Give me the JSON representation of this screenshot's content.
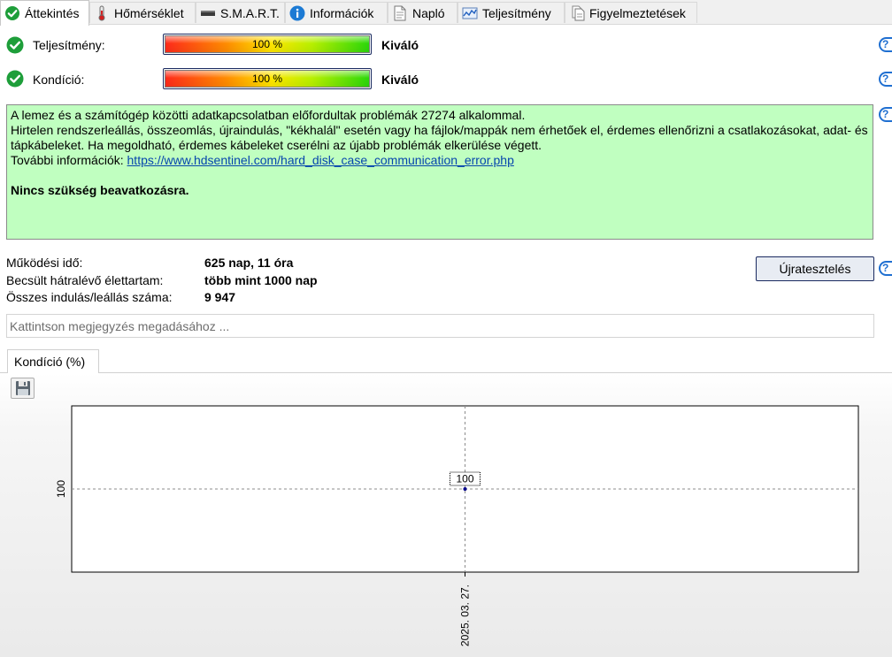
{
  "tabs": [
    {
      "label": "Áttekintés",
      "icon": "check-circle-icon"
    },
    {
      "label": "Hőmérséklet",
      "icon": "thermometer-icon"
    },
    {
      "label": "S.M.A.R.T.",
      "icon": "drive-icon"
    },
    {
      "label": "Információk",
      "icon": "info-icon"
    },
    {
      "label": "Napló",
      "icon": "document-icon"
    },
    {
      "label": "Teljesítmény",
      "icon": "performance-chart-icon"
    },
    {
      "label": "Figyelmeztetések",
      "icon": "alerts-icon"
    }
  ],
  "performance": {
    "label": "Teljesítmény:",
    "value": 100,
    "value_text": "100 %",
    "rating": "Kiváló"
  },
  "health": {
    "label": "Kondíció:",
    "value": 100,
    "value_text": "100 %",
    "rating": "Kiváló"
  },
  "message": {
    "line1": "A lemez és a számítógép közötti adatkapcsolatban előfordultak problémák 27274 alkalommal.",
    "line2": "Hirtelen rendszerleállás, összeomlás, újraindulás, \"kékhalál\" esetén vagy ha fájlok/mappák nem érhetőek el, érdemes ellenőrizni a csatlakozásokat, adat- és tápkábeleket. Ha megoldható, érdemes kábeleket cserélni az újabb problémák elkerülése végett.",
    "more_label": "További információk:",
    "link": "https://www.hdsentinel.com/hard_disk_case_communication_error.php",
    "action": "Nincs szükség beavatkozásra."
  },
  "info": [
    {
      "label": "Működési idő:",
      "value": "625 nap, 11 óra"
    },
    {
      "label": "Becsült hátralévő élettartam:",
      "value": "több mint 1000 nap"
    },
    {
      "label": "Összes indulás/leállás száma:",
      "value": "9 947"
    }
  ],
  "retest_label": "Újratesztelés",
  "note_placeholder": "Kattintson megjegyzés megadásához ...",
  "chart_tab_label": "Kondíció  (%)",
  "colors": {
    "message_bg": "#c0ffc0",
    "link": "#0645ad",
    "check_green": "#1e9e3a",
    "help_blue": "#1f6fd1"
  },
  "chart_data": {
    "type": "line",
    "title": "",
    "xlabel": "",
    "ylabel": "",
    "x": [
      "2025. 03. 27."
    ],
    "series": [
      {
        "values": [
          100
        ]
      }
    ],
    "ylim": [
      99,
      101
    ],
    "yticks": [
      "100"
    ],
    "xticks": [
      "2025. 03. 27."
    ],
    "data_labels": [
      "100"
    ],
    "grid": true
  }
}
